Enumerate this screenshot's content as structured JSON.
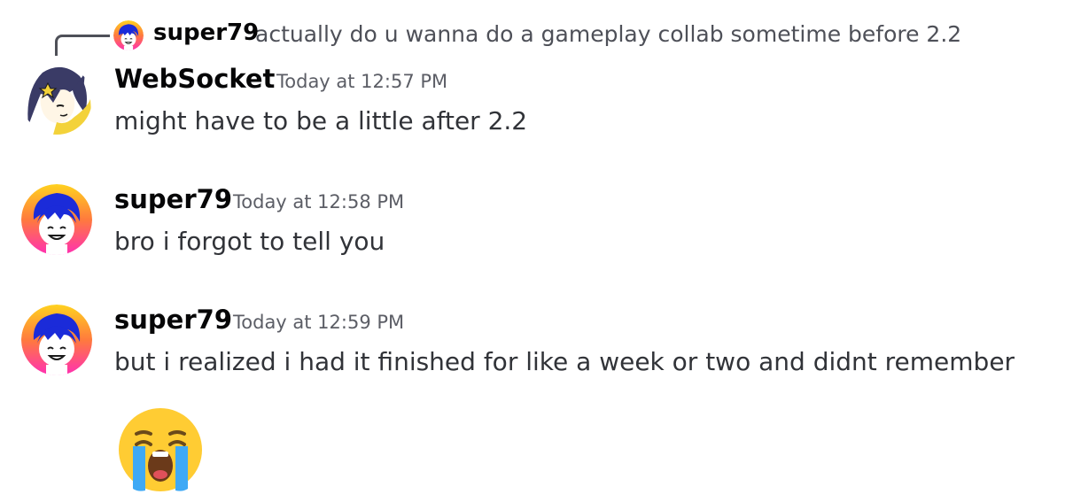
{
  "reply": {
    "author": "super79",
    "text": "actually do u wanna do a gameplay collab sometime before 2.2"
  },
  "messages": [
    {
      "author": "WebSocket",
      "timestamp": "Today at 12:57 PM",
      "content": "might have to be a little after 2.2",
      "avatar_icon": "anime-avatar-websocket"
    },
    {
      "author": "super79",
      "timestamp": "Today at 12:58 PM",
      "content": "bro i forgot to tell you",
      "avatar_icon": "anime-avatar-super79"
    },
    {
      "author": "super79",
      "timestamp": "Today at 12:59 PM",
      "content": "but i realized i had it finished for like a week or two and didnt remember",
      "avatar_icon": "anime-avatar-super79"
    }
  ],
  "emoji": {
    "name": "loudly-crying-face-emoji"
  },
  "colors": {
    "text": "#313338",
    "author": "#060607",
    "muted": "#5c5e66",
    "emoji_yellow": "#ffcc33",
    "tears": "#3fa9f5"
  }
}
